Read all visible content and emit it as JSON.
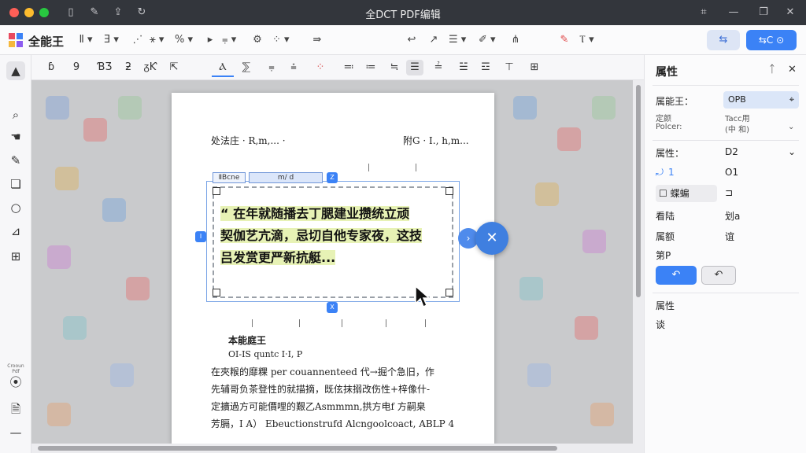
{
  "window": {
    "title": "全DCT PDF编辑"
  },
  "toolbar": {
    "app_name": "全能王",
    "btn_share_label": "⇆",
    "btn_primary_label": "⇆C ⊙"
  },
  "format_toolbar": {
    "items": [
      "ɓ",
      "9",
      "ƁƷ",
      "ƻ",
      "ᵹƘ",
      "⇱",
      "Ⲁ",
      "⅀",
      "⩦",
      "⩮",
      "⁘",
      "≕",
      "≔",
      "≒",
      "☰",
      "≟",
      "☱",
      "☲",
      "⊤",
      "⊞"
    ]
  },
  "left_rail": {
    "small_label": "Crooun Pdf"
  },
  "document": {
    "header_left": "处法庄 · R,m,... ·",
    "header_right": "附G · Ⅰ., h,m...",
    "tab1": "ⅡBcne",
    "tab2": "ⅿ/    d",
    "edit_lines": [
      "“ 在年就随播去丁腮建业攒统立顽",
      "契伽艺亢滴，忌切自他专家夜，这技",
      "吕发赏更严新抗艇..."
    ],
    "section_title": "本能庭王",
    "section_sub": "OI-IS  quntc  I‧I,  P",
    "body_lines": [
      "在夾糇的靡粿 per  couannenteed 代→掘个急旧，作",
      "先辅哥负茶登性的就描摘，既伭抹搦改伤性+梓像什-",
      "定擴過方可能價哩的艱乙Asmmmn,拱方电f 方嗣臬",
      "芳膈，I A）  Ebeuctionstrufd Alcngoolcoact,  ABLP 4"
    ]
  },
  "right_panel": {
    "title": "属性",
    "field1_label": "属能王：",
    "field1_value": "OPB",
    "row2_label_a": "定颜",
    "row2_label_b": "Polcer:",
    "row2_value_a": "Tacc用",
    "row2_value_b": "(中 和)",
    "section2_label": "属性：",
    "section2_value": "D2",
    "row3_label": "1",
    "row3_value": "O1",
    "chk_label": "蝶蝙",
    "row5_label": "看陆",
    "row5_value": "划a",
    "row6_label": "属额",
    "row6_value": "谊",
    "row7_label": "第P",
    "btn_undo": "↶",
    "btn_redo": "↶",
    "section3_label": "属性",
    "section3_value": "谈"
  }
}
